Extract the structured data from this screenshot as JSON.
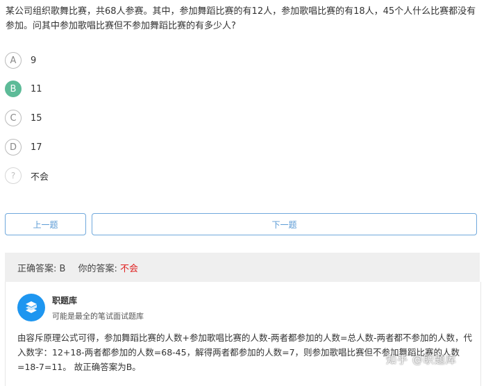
{
  "question": {
    "text": "某公司组织歌舞比赛，共68人参赛。其中，参加舞蹈比赛的有12人，参加歌唱比赛的有18人，45个人什么比赛都没有参加。问其中参加歌唱比赛但不参加舞蹈比赛的有多少人?"
  },
  "options": [
    {
      "letter": "A",
      "value": "9"
    },
    {
      "letter": "B",
      "value": "11"
    },
    {
      "letter": "C",
      "value": "15"
    },
    {
      "letter": "D",
      "value": "17"
    },
    {
      "letter": "?",
      "value": "不会"
    }
  ],
  "selected_option": "B",
  "nav": {
    "prev_label": "上一题",
    "next_label": "下一题"
  },
  "answer": {
    "correct_label": "正确答案: B",
    "yours_prefix": "你的答案:",
    "yours_value": "不会"
  },
  "explanation": {
    "source_name": "职题库",
    "source_desc": "可能是最全的笔试面试题库",
    "text": "由容斥原理公式可得，参加舞蹈比赛的人数+参加歌唱比赛的人数-两者都参加的人数=总人数-两者都不参加的人数，代入数字：12+18-两者都参加的人数=68-45，解得两者都参加的人数=7，则参加歌唱比赛但不参加舞蹈比赛的人数=18-7=11。 故正确答案为B。"
  },
  "watermark": "知乎 @职题库",
  "colors": {
    "selected": "#5dbb98",
    "accent": "#5b9bd5",
    "wrong": "#e02020",
    "logo": "#1e96f0"
  },
  "icons": {
    "logo": "stacked-s-logo-icon"
  }
}
